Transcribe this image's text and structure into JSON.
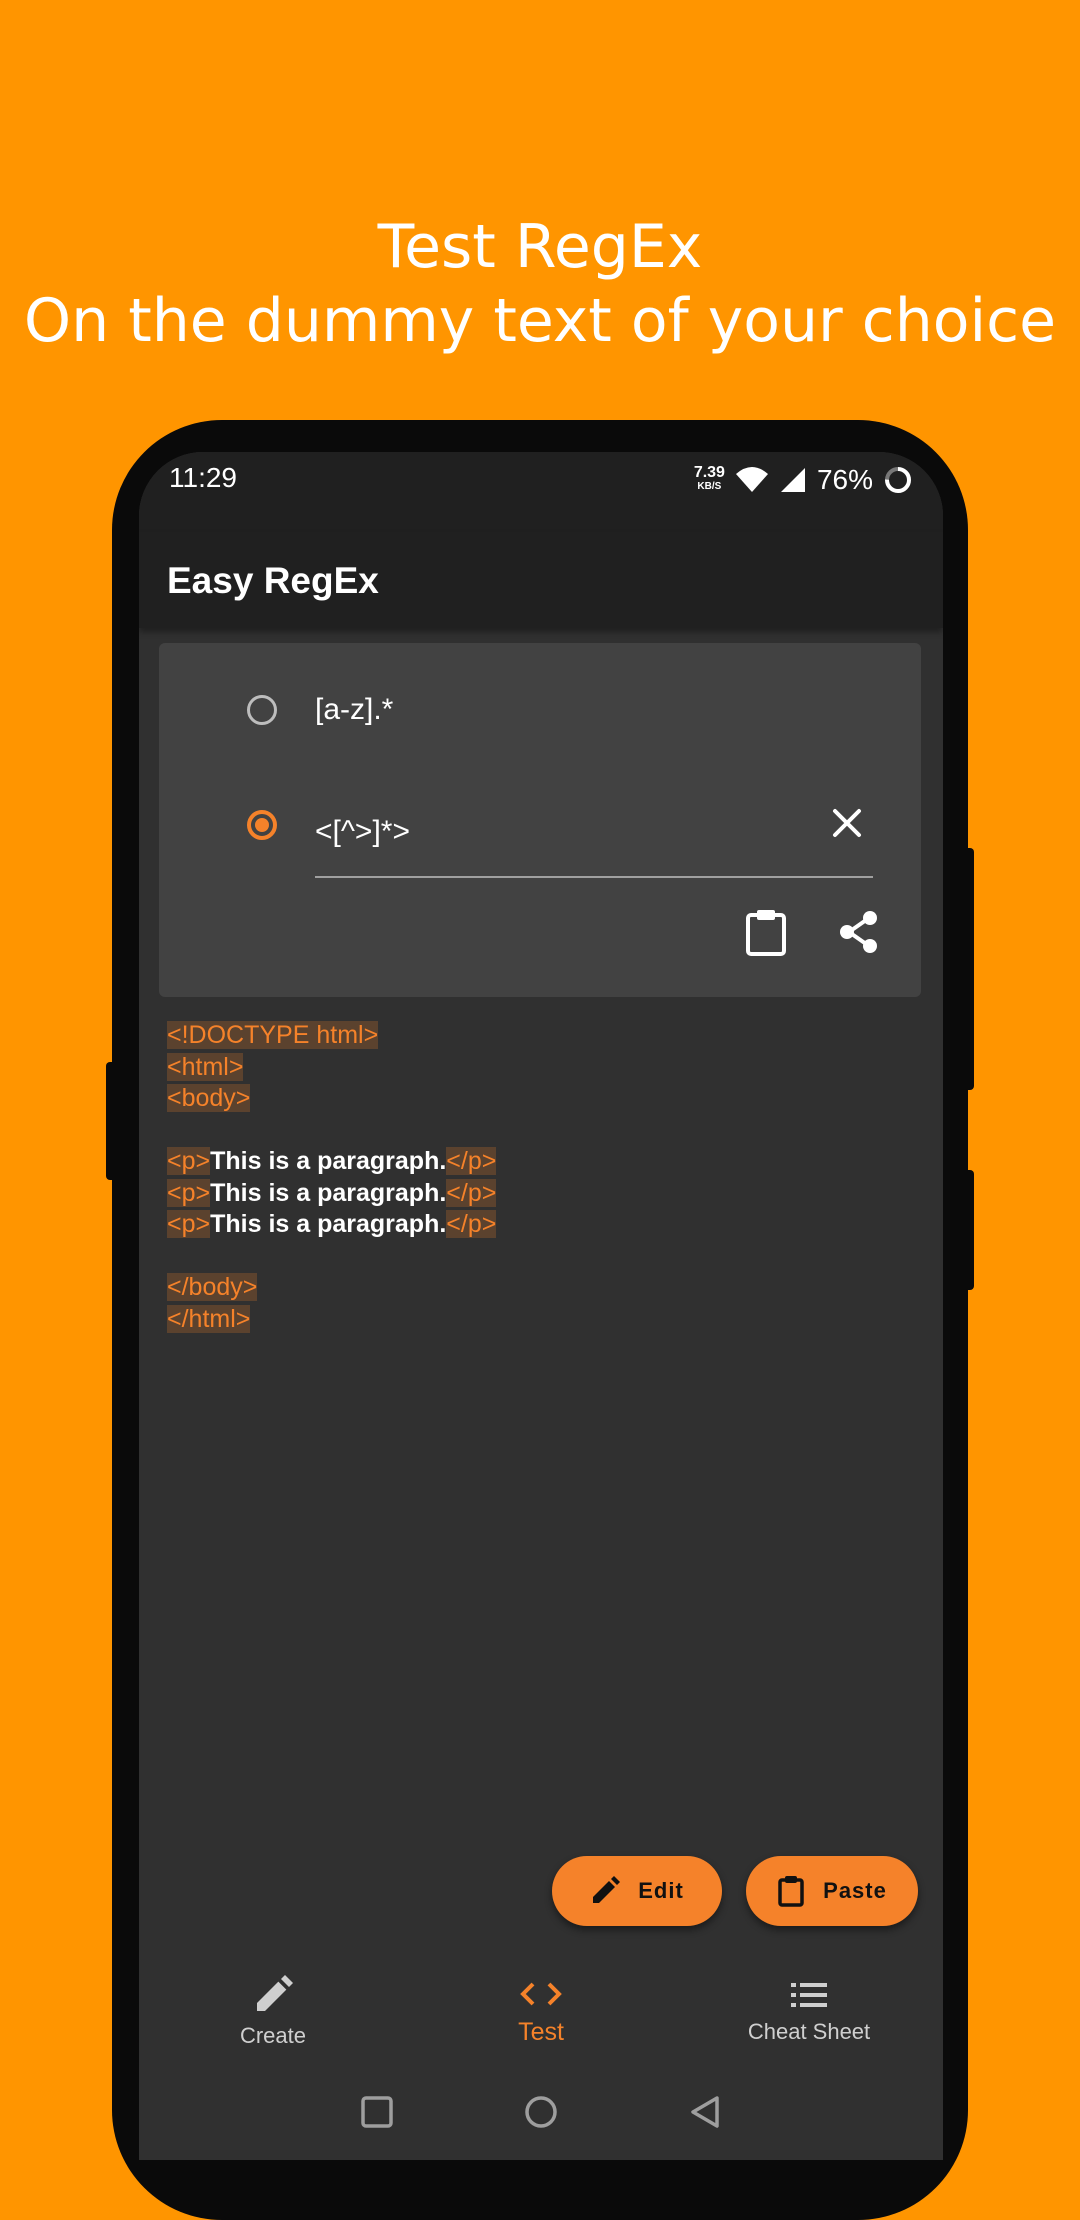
{
  "promo": {
    "line1": "Test RegEx",
    "line2": "On the dummy text of your choice"
  },
  "colors": {
    "background": "#FF9500",
    "accent": "#F5822A",
    "surface": "#303030",
    "card": "#424242",
    "appbar": "#202020"
  },
  "statusbar": {
    "time": "11:29",
    "speed_value": "7.39",
    "speed_unit": "KB/S",
    "battery": "76%"
  },
  "appbar": {
    "title": "Easy RegEx"
  },
  "patterns": {
    "option1": "[a-z].*",
    "option2": "<[^>]*>",
    "selected": "option2"
  },
  "test_text": {
    "line1": "<!DOCTYPE html>",
    "line2": "<html>",
    "line3": "<body>",
    "p_open": "<p>",
    "p_text": "This is a paragraph.",
    "p_close": "</p>",
    "line9": "</body>",
    "line10": "</html>"
  },
  "fabs": {
    "edit": "Edit",
    "paste": "Paste"
  },
  "bottom_nav": {
    "create": "Create",
    "test": "Test",
    "cheat_sheet": "Cheat Sheet",
    "active": "test"
  },
  "icons": {
    "clear": "close-icon",
    "clipboard": "clipboard-icon",
    "share": "share-icon",
    "edit": "pencil-icon",
    "test": "code-icon",
    "cheat_sheet": "list-icon"
  }
}
